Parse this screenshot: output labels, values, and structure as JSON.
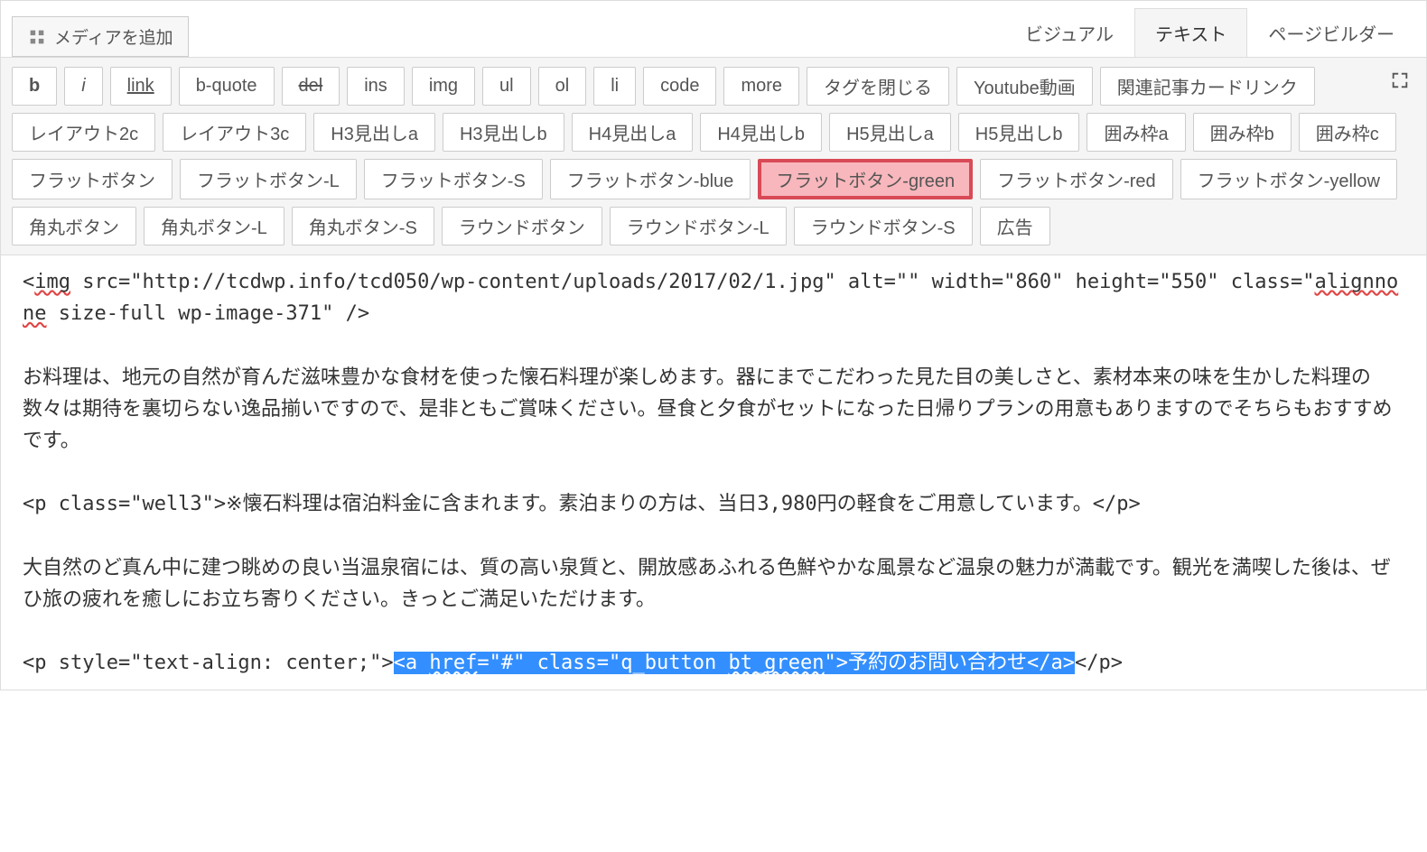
{
  "media_button": {
    "label": "メディアを追加"
  },
  "tabs": {
    "visual": "ビジュアル",
    "text": "テキスト",
    "page_builder": "ページビルダー"
  },
  "quicktags": {
    "row1": {
      "b": "b",
      "i": "i",
      "link": "link",
      "bquote": "b-quote",
      "del": "del",
      "ins": "ins",
      "img": "img",
      "ul": "ul",
      "ol": "ol",
      "li": "li",
      "code": "code",
      "more": "more",
      "close": "タグを閉じる",
      "youtube": "Youtube動画"
    },
    "row2": {
      "related": "関連記事カードリンク",
      "layout2c": "レイアウト2c",
      "layout3c": "レイアウト3c",
      "h3a": "H3見出しa",
      "h3b": "H3見出しb",
      "h4a": "H4見出しa",
      "h4b": "H4見出しb",
      "h5a": "H5見出しa"
    },
    "row3": {
      "h5b": "H5見出しb",
      "box_a": "囲み枠a",
      "box_b": "囲み枠b",
      "box_c": "囲み枠c",
      "flat": "フラットボタン",
      "flat_l": "フラットボタン-L",
      "flat_s": "フラットボタン-S",
      "flat_blue": "フラットボタン-blue"
    },
    "row4": {
      "flat_green": "フラットボタン-green",
      "flat_red": "フラットボタン-red",
      "flat_yellow": "フラットボタン-yellow",
      "round": "角丸ボタン",
      "round_l": "角丸ボタン-L",
      "round_s": "角丸ボタン-S",
      "oval": "ラウンドボタン"
    },
    "row5": {
      "oval_l": "ラウンドボタン-L",
      "oval_s": "ラウンドボタン-S",
      "ad": "広告"
    }
  },
  "content": {
    "line1_a": "<",
    "line1_img": "img",
    "line1_b": " src=\"http://tcdwp.info/tcd050/wp-content/uploads/2017/02/1.jpg\" alt=\"\" width=\"860\" height=\"550\" class=\"",
    "line1_align": "alignnone",
    "line1_c": " size-full wp-image-371\" />",
    "para1": "お料理は、地元の自然が育んだ滋味豊かな食材を使った懐石料理が楽しめます。器にまでこだわった見た目の美しさと、素材本来の味を生かした料理の数々は期待を裏切らない逸品揃いですので、是非ともご賞味ください。昼食と夕食がセットになった日帰りプランの用意もありますのでそちらもおすすめです。",
    "para2": "<p class=\"well3\">※懐石料理は宿泊料金に含まれます。素泊まりの方は、当日3,980円の軽食をご用意しています。</p>",
    "para3": "大自然のど真ん中に建つ眺めの良い当温泉宿には、質の高い泉質と、開放感あふれる色鮮やかな風景など温泉の魅力が満載です。観光を満喫した後は、ぜひ旅の疲れを癒しにお立ち寄りください。きっとご満足いただけます。",
    "para4_a": "<p style=\"text-align: center;\">",
    "para4_hl_a": "<a ",
    "para4_hl_href": "href",
    "para4_hl_b": "=\"#\" class=\"q_button ",
    "para4_hl_bt": "bt_green",
    "para4_hl_c": "\">予約のお問い合わせ</a>",
    "para4_b": "</p>"
  }
}
